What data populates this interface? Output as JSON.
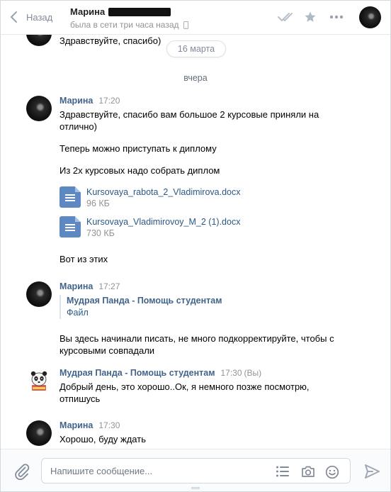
{
  "header": {
    "back_label": "Назад",
    "peer_name": "Марина",
    "peer_status": "была в сети три часа назад",
    "icons": [
      "back-chevron-icon",
      "double-check-icon",
      "star-icon",
      "more-icon",
      "phone-icon"
    ]
  },
  "history": {
    "first_message_text": "Здравствуйте, спасибо)",
    "date_pill": "16 марта",
    "day_separator": "вчера",
    "messages": [
      {
        "author": "Марина",
        "time": "17:20",
        "paragraphs": [
          "Здравствуйте, спасибо вам большое 2 курсовые приняли на отлично)",
          "Теперь можно приступать к диплому",
          "Из 2х курсовых надо собрать диплом"
        ],
        "documents": [
          {
            "name": "Kursovaya_rabota_2_Vladimirova.docx",
            "size": "96 КБ"
          },
          {
            "name": "Kursovaya_Vladimirovoy_M_2 (1).docx",
            "size": "730 КБ"
          }
        ],
        "after_docs": "Вот из этих"
      },
      {
        "author": "Марина",
        "time": "17:27",
        "forward": {
          "author": "Мудрая Панда - Помощь студентам",
          "text": "Файл"
        },
        "text": "Вы здесь начинали писать, не много подкорректируйте, чтобы с курсовыми совпадали"
      },
      {
        "author": "Мудрая Панда - Помощь студентам",
        "time": "17:30",
        "you_tag": "(Вы)",
        "text": "Добрый день, это хорошо..Ок, я немного позже посмотрю, отпишусь"
      },
      {
        "author": "Марина",
        "time": "17:30",
        "text": "Хорошо, буду ждать"
      }
    ]
  },
  "composer": {
    "placeholder": "Напишите сообщение...",
    "icons": [
      "paperclip-icon",
      "template-list-icon",
      "camera-icon",
      "emoji-icon",
      "send-icon"
    ]
  },
  "colors": {
    "link": "#2a5885",
    "author": "#42648b",
    "muted": "#939393",
    "doc_icon": "#5d88c2",
    "border": "#d3d9de"
  }
}
